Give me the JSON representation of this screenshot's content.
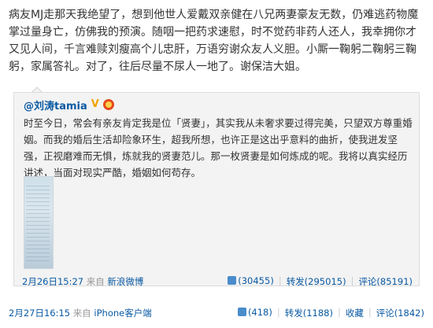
{
  "post": {
    "text": "病友MJ走那天我绝望了，想到他世人爱戴双亲健在八兄两妻豪友无数，仍难逃药物魔掌过量身亡，仿佛我的预演。随咽一把药求速慰，时不觉药非药人还人，我幸拥你才又见人间，千言难赎刘瘦高个儿忠肝，万语穷谢众友人义胆。小厮一鞠躬二鞠躬三鞠躬，家属答礼。对了，往后尽量不尿人一地了。谢保洁大姐。",
    "time": "2月27日16:15",
    "source_prefix": "来自",
    "source": "iPhone客户端",
    "actions": {
      "like_count": "(418)",
      "forward": "转发(1188)",
      "favorite": "收藏",
      "comment": "评论(1842)"
    }
  },
  "quote": {
    "author": "@刘涛tamia",
    "verified": "V",
    "text": "时至今日，常会有亲友肯定我是位「贤妻」，其实我从未奢求要过得完美，只望双方尊重婚姻。而我的婚后生活却险象环生，超我所想，也许正是这出乎意料的曲折，使我迸发坚强，正视磨难而无惧，炼就我的贤妻范儿。那一枚贤妻是如何炼成的呢。我将以真实经历讲述，当面对现实严酷，婚姻如何苟存。",
    "time": "2月26日15:27",
    "source_prefix": "来自",
    "source": "新浪微博",
    "actions": {
      "like_count": "(30455)",
      "forward": "转发(295015)",
      "comment": "评论(85191)"
    }
  },
  "colors": {
    "link": "#0a5aa3",
    "meta": "#999999",
    "quote_bg": "#f3f3f3"
  }
}
